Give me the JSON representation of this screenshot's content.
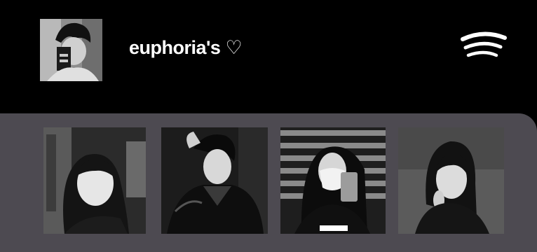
{
  "header": {
    "title": "euphoria's ♡",
    "cover_icon": "playlist-cover-image",
    "logo_icon": "spotify-icon"
  },
  "photos": [
    {
      "icon": "photo-1"
    },
    {
      "icon": "photo-2"
    },
    {
      "icon": "photo-3"
    },
    {
      "icon": "photo-4"
    }
  ],
  "colors": {
    "background": "#000000",
    "panel": "#4d4a51",
    "text": "#ffffff"
  }
}
